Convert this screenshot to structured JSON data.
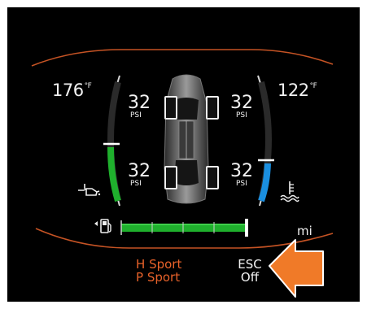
{
  "left_gauge": {
    "temperature": "176",
    "unit": "°F",
    "icon": "oil-temperature-icon",
    "color": "#1fb02d"
  },
  "right_gauge": {
    "temperature": "122",
    "unit": "°F",
    "icon": "coolant-temperature-icon",
    "color": "#1a8fe0"
  },
  "tires": {
    "front_left": {
      "pressure": "32",
      "unit": "PSI"
    },
    "front_right": {
      "pressure": "32",
      "unit": "PSI"
    },
    "rear_left": {
      "pressure": "32",
      "unit": "PSI"
    },
    "rear_right": {
      "pressure": "32",
      "unit": "PSI"
    }
  },
  "fuel": {
    "icon": "fuel-pump-icon",
    "unit": "mi",
    "color": "#1fb02d"
  },
  "drive_modes": {
    "h_letter": "H",
    "h_mode": "Sport",
    "p_letter": "P",
    "p_mode": "Sport",
    "color": "#e8622a"
  },
  "esc": {
    "line1": "ESC",
    "line2": "Off"
  },
  "annotation": {
    "icon": "orange-arrow-icon",
    "color": "#f07a28"
  },
  "accent": "#e8622a"
}
